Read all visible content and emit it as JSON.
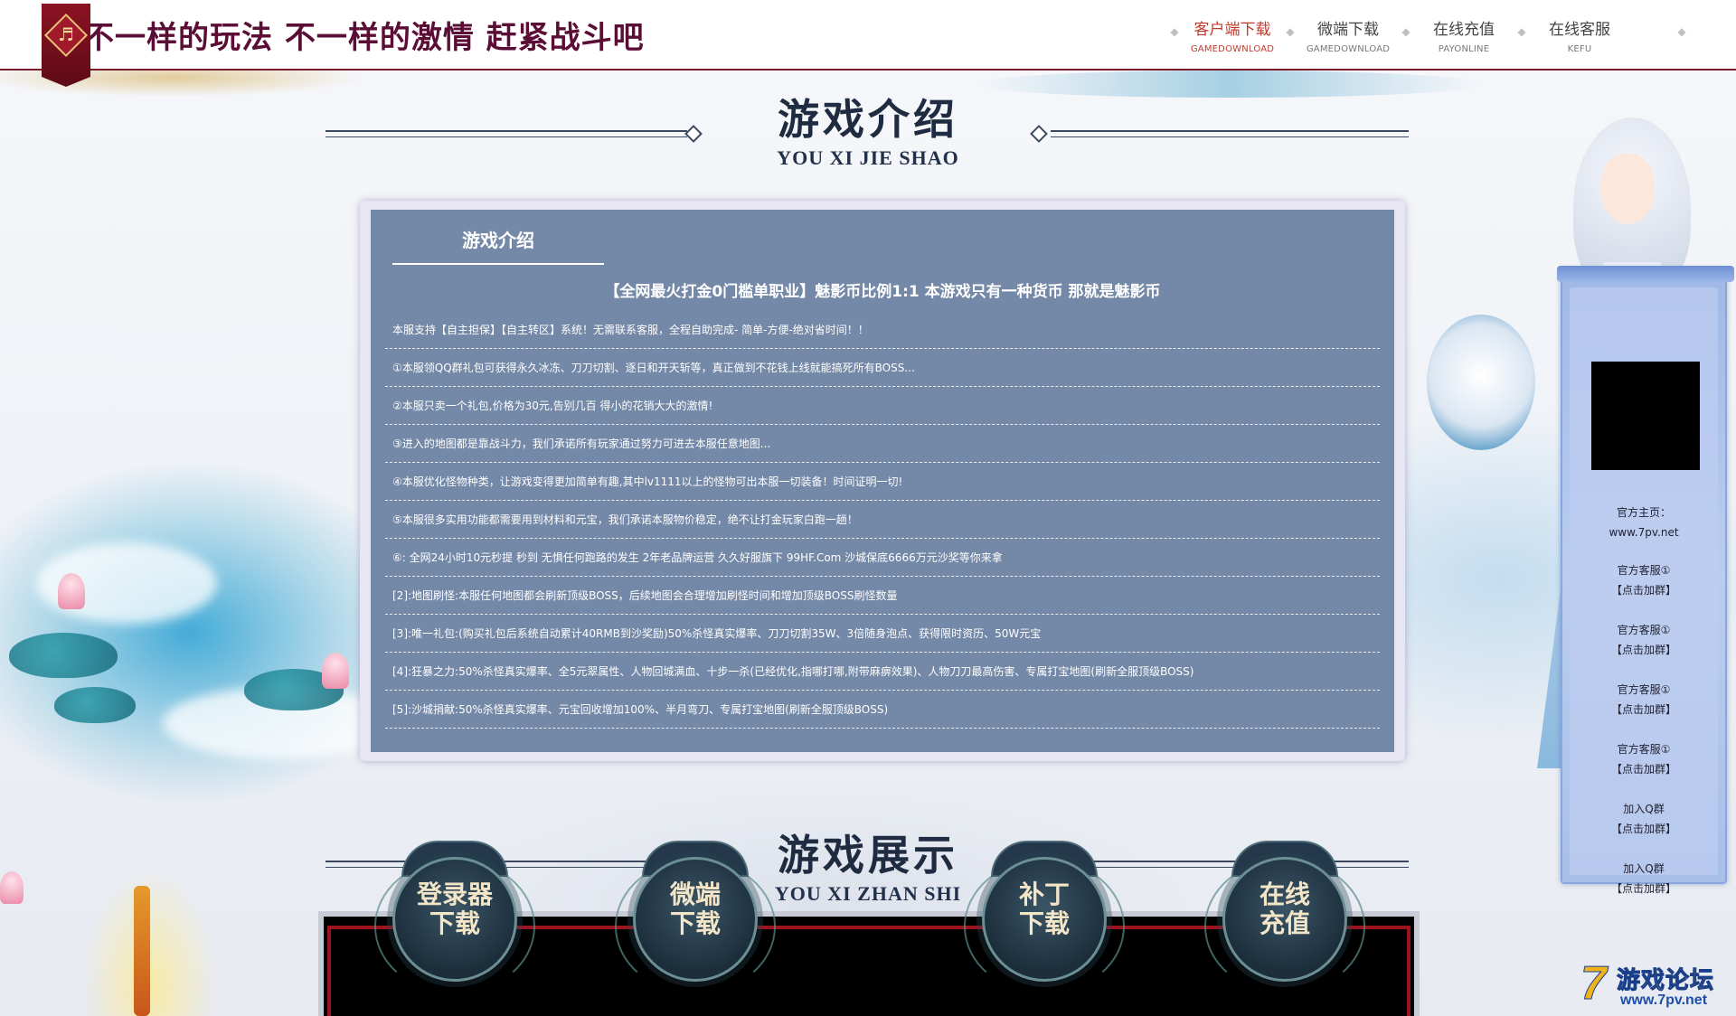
{
  "header": {
    "slogan": "不一样的玩法 不一样的激情 赶紧战斗吧",
    "logo_glyph": "♬",
    "nav": [
      {
        "label": "客户端下载",
        "sub": "GAMEDOWNLOAD",
        "active": true
      },
      {
        "label": "微端下载",
        "sub": "GAMEDOWNLOAD",
        "active": false
      },
      {
        "label": "在线充值",
        "sub": "PAYONLINE",
        "active": false
      },
      {
        "label": "在线客服",
        "sub": "KEFU",
        "active": false
      }
    ],
    "separator": "◆"
  },
  "intro_section": {
    "title": "游戏介绍",
    "subtitle": "YOU XI JIE SHAO"
  },
  "intro_panel": {
    "tab": "游戏介绍",
    "headline": "【全网最火打金0门槛单职业】魅影币比例1:1 本游戏只有一种货币 那就是魅影币",
    "lines": [
      "本服支持【自主担保】【自主转区】系统！无需联系客服，全程自助完成- 简单-方便-绝对省时间！！",
      "①本服领QQ群礼包可获得永久冰冻、刀刀切割、逐日和开天斩等，真正做到不花钱上线就能搞死所有BOSS...",
      "②本服只卖一个礼包,价格为30元,告别几百 得小的花销大大的激情!",
      "③进入的地图都是靠战斗力，我们承诺所有玩家通过努力可进去本服任意地图...",
      "④本服优化怪物种类，让游戏变得更加简单有趣,其中lv1111以上的怪物可出本服一切装备！时间证明一切!",
      "⑤本服很多实用功能都需要用到材料和元宝，我们承诺本服物价稳定，绝不让打金玩家白跑一趟！",
      "⑥: 全网24小时10元秒提 秒到 无惧任何跑路的发生 2年老品牌运营 久久好服旗下 99HF.Com 沙城保底6666万元沙奖等你来拿",
      "[2]:地图刷怪:本服任何地图都会刷新顶级BOSS，后续地图会合理增加刷怪时间和增加顶级BOSS刷怪数量",
      "[3]:唯一礼包:(购买礼包后系统自动累计40RMB到沙奖励)50%杀怪真实爆率、刀刀切割35W、3倍随身泡点、获得限时资历、50W元宝",
      "[4]:狂暴之力:50%杀怪真实爆率、全5元翠属性、人物回城满血、十步一杀(已经优化,指哪打哪,附带麻痹效果)、人物刀刀最高伤害、专属打宝地图(刷新全服顶级BOSS)",
      "[5]:沙城捐献:50%杀怪真实爆率、元宝回收增加100%、半月弯刀、专属打宝地图(刷新全服顶级BOSS)"
    ]
  },
  "sidebar": {
    "homepage_label": "官方主页：",
    "homepage_url": "www.7pv.net",
    "items": [
      {
        "label": "官方客服①",
        "action": "【点击加群】"
      },
      {
        "label": "官方客服①",
        "action": "【点击加群】"
      },
      {
        "label": "官方客服①",
        "action": "【点击加群】"
      },
      {
        "label": "官方客服①",
        "action": "【点击加群】"
      },
      {
        "label": "加入Q群",
        "action": "【点击加群】"
      },
      {
        "label": "加入Q群",
        "action": "【点击加群】"
      }
    ]
  },
  "showcase_section": {
    "title": "游戏展示",
    "subtitle": "YOU XI ZHAN SHI",
    "buttons": [
      {
        "label": "登录器\n下载"
      },
      {
        "label": "微端\n下载"
      },
      {
        "label": "补丁\n下载"
      },
      {
        "label": "在线\n充值"
      }
    ]
  },
  "watermark": {
    "seven": "7",
    "title": "游戏论坛",
    "url": "www.7pv.net"
  },
  "colors": {
    "nav_active": "#c0392b",
    "panel_bg": "#7488a7",
    "header_border": "#7a1a2a",
    "slogan": "#5a0d35"
  }
}
